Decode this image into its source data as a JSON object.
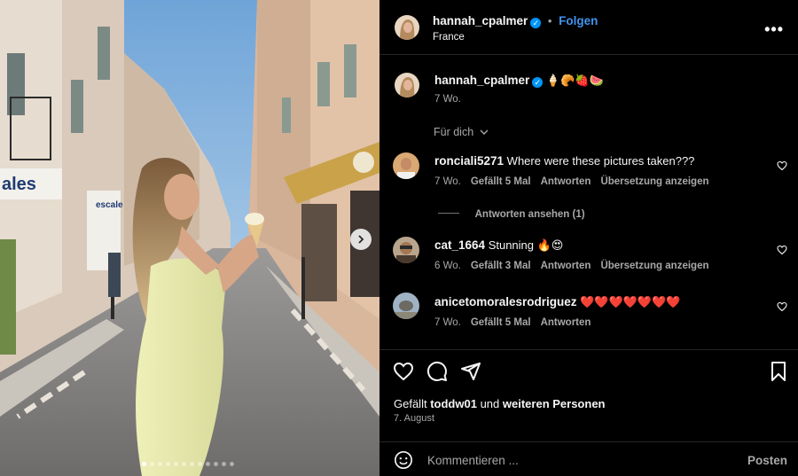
{
  "header": {
    "username": "hannah_cpalmer",
    "separator": "•",
    "follow_label": "Folgen",
    "location": "France",
    "more_label": "•••"
  },
  "caption": {
    "username": "hannah_cpalmer",
    "emojis": "🍦🥐🍓🍉",
    "time": "7 Wo."
  },
  "sort": {
    "label": "Für dich"
  },
  "comments": [
    {
      "username": "ronciali5271",
      "text": "Where were these pictures taken???",
      "time": "7 Wo.",
      "likes": "Gefällt 5 Mal",
      "reply": "Antworten",
      "translate": "Übersetzung anzeigen"
    },
    {
      "username": "cat_1664",
      "text": "Stunning 🔥😍",
      "time": "6 Wo.",
      "likes": "Gefällt 3 Mal",
      "reply": "Antworten",
      "translate": "Übersetzung anzeigen"
    },
    {
      "username": "anicetomoralesrodriguez",
      "text": "❤️❤️❤️❤️❤️❤️❤️",
      "time": "7 Wo.",
      "likes": "Gefällt 5 Mal",
      "reply": "Antworten"
    }
  ],
  "view_replies": {
    "label": "Antworten ansehen (1)"
  },
  "likes": {
    "prefix": "Gefällt",
    "user": "toddw01",
    "middle": "und",
    "suffix": "weiteren Personen"
  },
  "date": "7. August",
  "composer": {
    "placeholder": "Kommentieren ...",
    "post_label": "Posten"
  },
  "carousel": {
    "total": 12,
    "active": 0
  },
  "colors": {
    "accent": "#0095f6",
    "link": "#4193ef",
    "background": "#000000",
    "muted": "#a8a8a8"
  }
}
